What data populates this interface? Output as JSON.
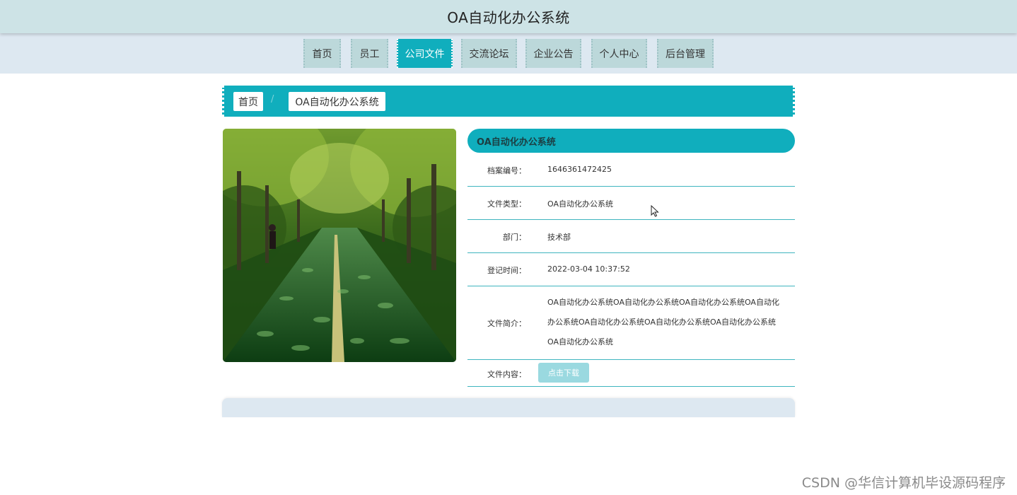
{
  "header": {
    "title": "OA自动化办公系统"
  },
  "nav": {
    "items": [
      {
        "label": "首页"
      },
      {
        "label": "员工"
      },
      {
        "label": "公司文件"
      },
      {
        "label": "交流论坛"
      },
      {
        "label": "企业公告"
      },
      {
        "label": "个人中心"
      },
      {
        "label": "后台管理"
      }
    ],
    "active_index": 2
  },
  "breadcrumb": {
    "home": "首页",
    "separator": "/",
    "current": "OA自动化办公系统"
  },
  "detail": {
    "title": "OA自动化办公系统",
    "fields": [
      {
        "label": "档案编号：",
        "value": "1646361472425"
      },
      {
        "label": "文件类型：",
        "value": "OA自动化办公系统"
      },
      {
        "label": "部门：",
        "value": "技术部"
      },
      {
        "label": "登记时间：",
        "value": "2022-03-04 10:37:52"
      },
      {
        "label": "文件简介：",
        "value": "OA自动化办公系统OA自动化办公系统OA自动化办公系统OA自动化办公系统OA自动化办公系统OA自动化办公系统OA自动化办公系统OA自动化办公系统"
      },
      {
        "label": "文件内容：",
        "value": ""
      }
    ],
    "download_label": "点击下载"
  },
  "colors": {
    "accent": "#10aebd",
    "header_bg": "#cde3e6",
    "nav_bg": "#dde8f1",
    "nav_item_bg": "#bcd8da"
  },
  "watermark": "CSDN @华信计算机毕设源码程序"
}
